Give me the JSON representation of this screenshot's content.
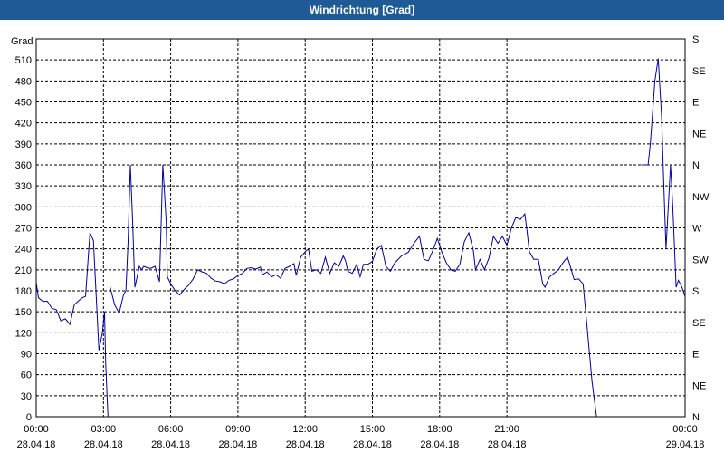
{
  "window": {
    "title": "Windrichtung [Grad]"
  },
  "chart_data": {
    "type": "line",
    "title": "Windrichtung [Grad]",
    "ylabel": "Grad",
    "xlabel": "",
    "ylim": [
      0,
      540
    ],
    "y_ticks": [
      0,
      30,
      60,
      90,
      120,
      150,
      180,
      210,
      240,
      270,
      300,
      330,
      360,
      390,
      420,
      450,
      480,
      510
    ],
    "right_axis_labels": [
      "N",
      "NE",
      "E",
      "SE",
      "S",
      "SW",
      "W",
      "NW",
      "N",
      "NE",
      "E",
      "SE",
      "S"
    ],
    "right_axis_values": [
      0,
      45,
      90,
      135,
      180,
      225,
      270,
      315,
      360,
      405,
      450,
      495,
      540
    ],
    "x_tick_labels": [
      {
        "time": "00:00",
        "date": "28.04.18"
      },
      {
        "time": "03:00",
        "date": "28.04.18"
      },
      {
        "time": "06:00",
        "date": "28.04.18"
      },
      {
        "time": "09:00",
        "date": "28.04.18"
      },
      {
        "time": "12:00",
        "date": "28.04.18"
      },
      {
        "time": "15:00",
        "date": "28.04.18"
      },
      {
        "time": "18:00",
        "date": "28.04.18"
      },
      {
        "time": "21:00",
        "date": "28.04.18"
      },
      {
        "time": "00:00",
        "date": "29.04.18"
      }
    ],
    "grid": true,
    "series_color": "#0000a0",
    "series": [
      {
        "segments": [
          [
            [
              0.0,
              192
            ],
            [
              0.1,
              170
            ],
            [
              0.3,
              165
            ],
            [
              0.5,
              165
            ],
            [
              0.7,
              155
            ],
            [
              0.9,
              153
            ],
            [
              1.1,
              137
            ],
            [
              1.3,
              140
            ],
            [
              1.5,
              132
            ],
            [
              1.7,
              160
            ],
            [
              1.9,
              166
            ],
            [
              2.05,
              170
            ],
            [
              2.2,
              172
            ],
            [
              2.4,
              263
            ],
            [
              2.55,
              252
            ],
            [
              2.8,
              95
            ],
            [
              2.95,
              120
            ],
            [
              3.05,
              150
            ],
            [
              3.1,
              75
            ],
            [
              3.2,
              0
            ]
          ],
          [
            [
              3.3,
              185
            ],
            [
              3.5,
              160
            ],
            [
              3.7,
              148
            ],
            [
              3.9,
              175
            ],
            [
              4.0,
              180
            ],
            [
              4.1,
              250
            ],
            [
              4.2,
              360
            ],
            [
              4.3,
              280
            ],
            [
              4.4,
              185
            ],
            [
              4.5,
              200
            ],
            [
              4.6,
              215
            ],
            [
              4.7,
              210
            ],
            [
              4.8,
              215
            ],
            [
              4.95,
              213
            ],
            [
              5.1,
              212
            ],
            [
              5.3,
              215
            ],
            [
              5.5,
              193
            ],
            [
              5.65,
              360
            ],
            [
              5.8,
              280
            ],
            [
              5.85,
              200
            ],
            [
              6.0,
              190
            ],
            [
              6.2,
              180
            ],
            [
              6.4,
              174
            ],
            [
              6.6,
              182
            ],
            [
              6.8,
              188
            ],
            [
              7.0,
              197
            ],
            [
              7.2,
              210
            ],
            [
              7.4,
              207
            ],
            [
              7.6,
              205
            ],
            [
              7.8,
              198
            ],
            [
              8.0,
              194
            ],
            [
              8.2,
              193
            ],
            [
              8.4,
              190
            ],
            [
              8.6,
              195
            ],
            [
              8.8,
              197
            ],
            [
              9.0,
              202
            ],
            [
              9.2,
              205
            ],
            [
              9.4,
              212
            ],
            [
              9.6,
              213
            ],
            [
              9.8,
              211
            ],
            [
              10.0,
              214
            ],
            [
              10.1,
              203
            ],
            [
              10.3,
              207
            ],
            [
              10.5,
              200
            ],
            [
              10.7,
              203
            ],
            [
              10.9,
              198
            ],
            [
              11.1,
              212
            ],
            [
              11.3,
              215
            ],
            [
              11.5,
              219
            ],
            [
              11.6,
              202
            ],
            [
              11.8,
              228
            ],
            [
              12.0,
              236
            ],
            [
              12.15,
              240
            ],
            [
              12.3,
              208
            ],
            [
              12.5,
              210
            ],
            [
              12.7,
              205
            ],
            [
              12.9,
              228
            ],
            [
              13.1,
              205
            ],
            [
              13.3,
              220
            ],
            [
              13.5,
              215
            ],
            [
              13.7,
              230
            ],
            [
              13.8,
              223
            ],
            [
              13.9,
              208
            ],
            [
              14.1,
              205
            ],
            [
              14.3,
              218
            ],
            [
              14.45,
              200
            ],
            [
              14.6,
              218
            ],
            [
              14.8,
              218
            ],
            [
              15.0,
              222
            ],
            [
              15.2,
              240
            ],
            [
              15.4,
              245
            ],
            [
              15.6,
              215
            ],
            [
              15.8,
              208
            ],
            [
              16.0,
              220
            ],
            [
              16.3,
              230
            ],
            [
              16.6,
              235
            ],
            [
              16.9,
              250
            ],
            [
              17.1,
              258
            ],
            [
              17.3,
              225
            ],
            [
              17.5,
              223
            ],
            [
              17.7,
              238
            ],
            [
              17.9,
              255
            ],
            [
              18.1,
              235
            ],
            [
              18.3,
              220
            ],
            [
              18.5,
              210
            ],
            [
              18.7,
              208
            ],
            [
              18.9,
              218
            ],
            [
              19.1,
              250
            ],
            [
              19.3,
              263
            ],
            [
              19.5,
              238
            ],
            [
              19.6,
              210
            ],
            [
              19.8,
              225
            ],
            [
              20.0,
              210
            ],
            [
              20.2,
              227
            ],
            [
              20.4,
              258
            ],
            [
              20.6,
              248
            ],
            [
              20.8,
              258
            ],
            [
              21.0,
              245
            ],
            [
              21.2,
              270
            ],
            [
              21.4,
              285
            ],
            [
              21.6,
              282
            ],
            [
              21.8,
              290
            ],
            [
              21.9,
              265
            ],
            [
              22.0,
              236
            ],
            [
              22.2,
              225
            ],
            [
              22.4,
              225
            ],
            [
              22.6,
              190
            ],
            [
              22.7,
              185
            ],
            [
              22.9,
              200
            ],
            [
              23.1,
              205
            ],
            [
              23.3,
              210
            ],
            [
              23.5,
              220
            ],
            [
              23.7,
              228
            ],
            [
              23.8,
              218
            ],
            [
              24.0,
              196
            ],
            [
              24.2,
              197
            ],
            [
              24.4,
              190
            ],
            [
              24.6,
              120
            ],
            [
              24.8,
              50
            ],
            [
              25.0,
              0
            ]
          ],
          [
            [
              27.0,
              360
            ],
            [
              27.3,
              360
            ],
            [
              27.4,
              390
            ],
            [
              27.6,
              480
            ],
            [
              27.75,
              512
            ],
            [
              27.9,
              430
            ],
            [
              28.0,
              330
            ],
            [
              28.1,
              240
            ],
            [
              28.3,
              360
            ],
            [
              28.4,
              300
            ],
            [
              28.55,
              185
            ],
            [
              28.65,
              195
            ],
            [
              28.8,
              186
            ],
            [
              28.95,
              172
            ]
          ]
        ]
      }
    ]
  }
}
